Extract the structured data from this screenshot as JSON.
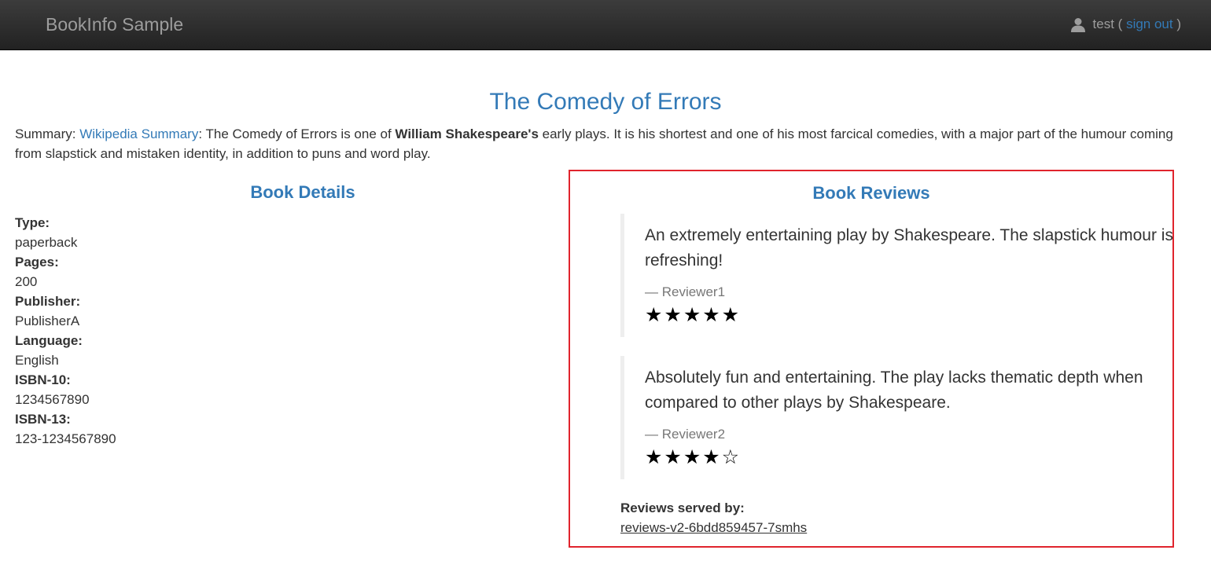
{
  "navbar": {
    "brand": "BookInfo Sample",
    "user_icon": "user-icon",
    "username": "test",
    "paren_open": " ( ",
    "sign_out": "sign out",
    "paren_close": " )"
  },
  "book": {
    "title": "The Comedy of Errors",
    "summary_label": "Summary: ",
    "summary_link": "Wikipedia Summary",
    "summary_text_1": ": The Comedy of Errors is one of ",
    "summary_author": "William Shakespeare's",
    "summary_text_2": " early plays. It is his shortest and one of his most farcical comedies, with a major part of the humour coming from slapstick and mistaken identity, in addition to puns and word play."
  },
  "details": {
    "heading": "Book Details",
    "items": [
      {
        "label": "Type:",
        "value": "paperback"
      },
      {
        "label": "Pages:",
        "value": "200"
      },
      {
        "label": "Publisher:",
        "value": "PublisherA"
      },
      {
        "label": "Language:",
        "value": "English"
      },
      {
        "label": "ISBN-10:",
        "value": "1234567890"
      },
      {
        "label": "ISBN-13:",
        "value": "123-1234567890"
      }
    ]
  },
  "reviews": {
    "heading": "Book Reviews",
    "items": [
      {
        "text": "An extremely entertaining play by Shakespeare. The slapstick humour is refreshing!",
        "reviewer": "— Reviewer1",
        "rating": 5,
        "stars": "★★★★★"
      },
      {
        "text": "Absolutely fun and entertaining. The play lacks thematic depth when compared to other plays by Shakespeare.",
        "reviewer": "— Reviewer2",
        "rating": 4,
        "stars": "★★★★☆"
      }
    ],
    "served_label": "Reviews served by:",
    "served_by": "reviews-v2-6bdd859457-7smhs"
  },
  "colors": {
    "accent": "#337ab7",
    "navbar_bg": "#222222",
    "highlight_border": "#e0242d"
  }
}
